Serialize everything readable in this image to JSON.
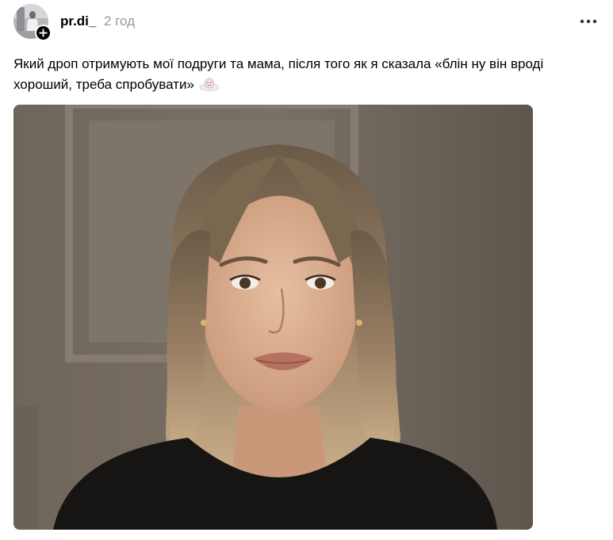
{
  "post": {
    "author": {
      "username": "pr.di_",
      "avatar_icon": "avatar-photo",
      "follow_icon": "plus-icon"
    },
    "timestamp": "2 год",
    "more_icon": "more-horizontal-icon",
    "text": "Який дроп отримують мої подруги та мама, після того як я сказала «блін ну він вроді хороший, треба спробувати»",
    "text_emoji_icon": "cloud-face-emoji-icon",
    "media": {
      "type": "photo",
      "subject": "woman-portrait"
    }
  },
  "colors": {
    "text": "#000000",
    "muted": "#999999",
    "badge": "#000000",
    "background": "#ffffff"
  }
}
